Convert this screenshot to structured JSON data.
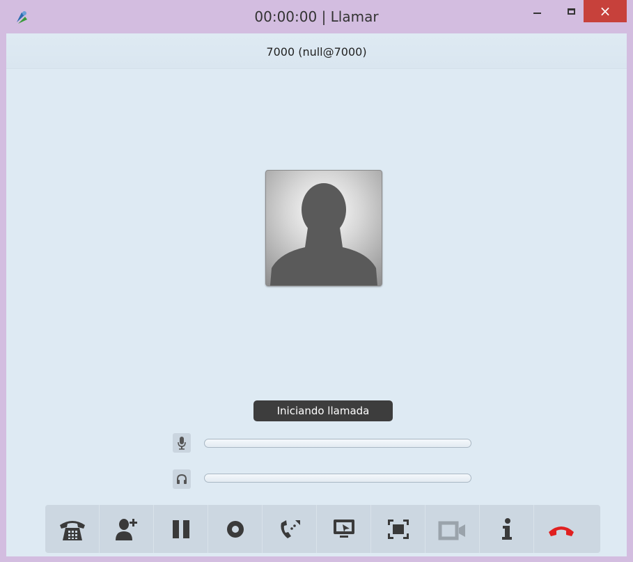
{
  "window": {
    "title": "00:00:00 | Llamar",
    "close_glyph": "×"
  },
  "call": {
    "contact": "7000 (null@7000)",
    "status": "Iniciando llamada"
  },
  "icons": {
    "app": "app-icon",
    "minimize": "minimize-icon",
    "maximize": "maximize-icon",
    "close": "close-icon",
    "microphone": "microphone-icon",
    "headphones": "headphones-icon"
  },
  "toolbar": {
    "buttons": [
      {
        "name": "dialpad-button",
        "icon": "dialpad-phone-icon"
      },
      {
        "name": "add-participant-button",
        "icon": "add-user-icon"
      },
      {
        "name": "hold-button",
        "icon": "pause-icon"
      },
      {
        "name": "record-button",
        "icon": "record-icon"
      },
      {
        "name": "transfer-button",
        "icon": "transfer-icon"
      },
      {
        "name": "share-screen-button",
        "icon": "desktop-share-icon"
      },
      {
        "name": "fullscreen-button",
        "icon": "fullscreen-icon"
      },
      {
        "name": "video-button",
        "icon": "video-camera-icon"
      },
      {
        "name": "info-button",
        "icon": "info-icon"
      },
      {
        "name": "hangup-button",
        "icon": "hangup-icon"
      }
    ]
  },
  "colors": {
    "titlebar": "#d3bde0",
    "background": "#deeaf3",
    "toolbar": "#ccd7e1",
    "close": "#c7413b",
    "hangup": "#e02020",
    "icon": "#3a3a3a"
  }
}
